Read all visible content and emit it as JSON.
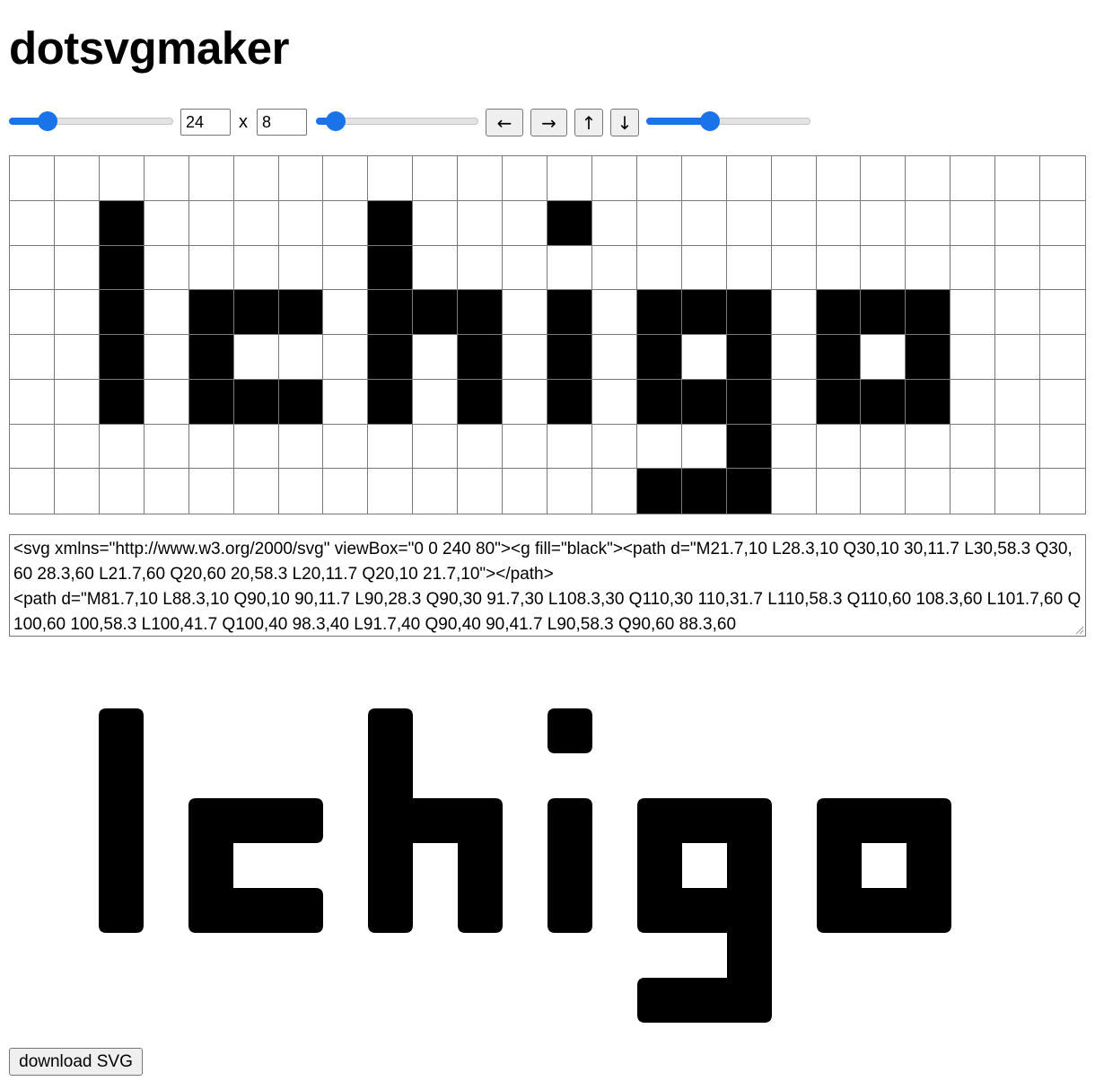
{
  "app": {
    "title": "dotsvgmaker"
  },
  "controls": {
    "cell_size_slider": {
      "value": 0.2
    },
    "grid_width": "24",
    "size_separator": "x",
    "grid_height": "8",
    "corner_radius_slider": {
      "value": 0.07
    },
    "arrows": {
      "left": "←",
      "right": "→",
      "up": "↑",
      "down": "↓"
    },
    "stroke_slider": {
      "value": 0.37
    }
  },
  "grid": {
    "columns": 24,
    "rows": 8,
    "filled_cells": [
      [
        1,
        2
      ],
      [
        1,
        8
      ],
      [
        1,
        12
      ],
      [
        2,
        2
      ],
      [
        2,
        8
      ],
      [
        3,
        2
      ],
      [
        3,
        4
      ],
      [
        3,
        5
      ],
      [
        3,
        6
      ],
      [
        3,
        8
      ],
      [
        3,
        9
      ],
      [
        3,
        10
      ],
      [
        3,
        12
      ],
      [
        3,
        14
      ],
      [
        3,
        15
      ],
      [
        3,
        16
      ],
      [
        3,
        18
      ],
      [
        3,
        19
      ],
      [
        3,
        20
      ],
      [
        4,
        2
      ],
      [
        4,
        4
      ],
      [
        4,
        8
      ],
      [
        4,
        10
      ],
      [
        4,
        12
      ],
      [
        4,
        14
      ],
      [
        4,
        16
      ],
      [
        4,
        18
      ],
      [
        4,
        20
      ],
      [
        5,
        2
      ],
      [
        5,
        4
      ],
      [
        5,
        5
      ],
      [
        5,
        6
      ],
      [
        5,
        8
      ],
      [
        5,
        10
      ],
      [
        5,
        12
      ],
      [
        5,
        14
      ],
      [
        5,
        15
      ],
      [
        5,
        16
      ],
      [
        5,
        18
      ],
      [
        5,
        19
      ],
      [
        5,
        20
      ],
      [
        6,
        16
      ],
      [
        7,
        14
      ],
      [
        7,
        15
      ],
      [
        7,
        16
      ]
    ]
  },
  "output": {
    "svg_code": "<svg xmlns=\"http://www.w3.org/2000/svg\" viewBox=\"0 0 240 80\"><g fill=\"black\"><path d=\"M21.7,10 L28.3,10 Q30,10 30,11.7 L30,58.3 Q30,60 28.3,60 L21.7,60 Q20,60 20,58.3 L20,11.7 Q20,10 21.7,10\"></path>\n<path d=\"M81.7,10 L88.3,10 Q90,10 90,11.7 L90,28.3 Q90,30 91.7,30 L108.3,30 Q110,30 110,31.7 L110,58.3 Q110,60 108.3,60 L101.7,60 Q100,60 100,58.3 L100,41.7 Q100,40 98.3,40 L91.7,40 Q90,40 90,41.7 L90,58.3 Q90,60 88.3,60"
  },
  "actions": {
    "download_label": "download SVG"
  },
  "colors": {
    "accent": "#1a73e8",
    "dot": "#000000",
    "grid_line": "#7a7a7a"
  }
}
